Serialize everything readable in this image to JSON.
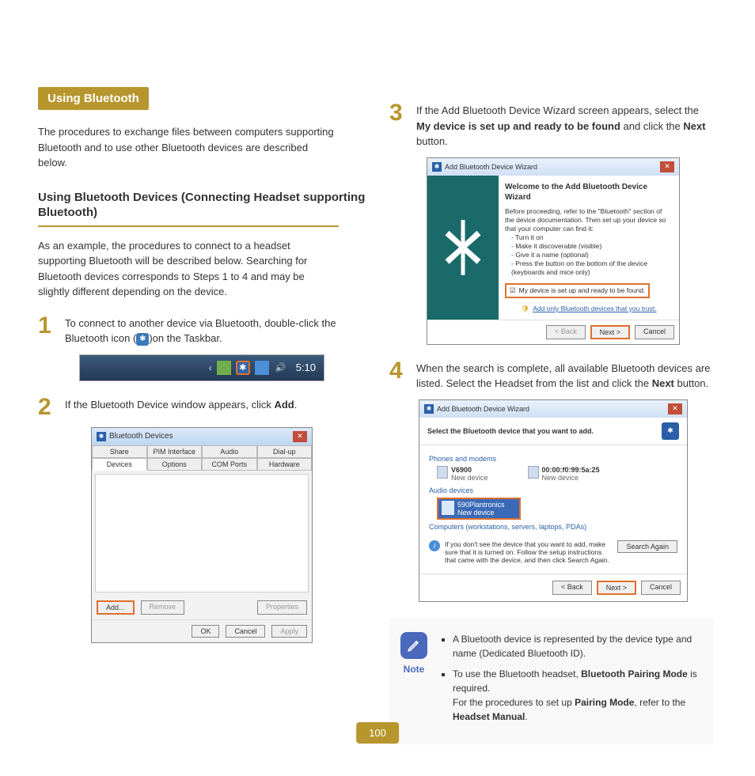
{
  "heading": "Using Bluetooth",
  "intro": "The procedures to exchange files between computers supporting Bluetooth and to use other Bluetooth devices are described below.",
  "sub_heading": "Using Bluetooth Devices (Connecting Headset supporting Bluetooth)",
  "sub_intro": "As an example, the procedures to connect to a headset supporting Bluetooth will be described below. Searching for Bluetooth devices corresponds to Steps 1 to 4 and may be slightly different depending on the device.",
  "step1": {
    "num": "1",
    "pre": "To connect to another device via Bluetooth, double-click the Bluetooth icon (",
    "post": ")on the Taskbar."
  },
  "taskbar": {
    "time": "5:10"
  },
  "step2": {
    "num": "2",
    "pre": "If the Bluetooth Device window appears, click ",
    "bold": "Add",
    "post": "."
  },
  "bt_devices_window": {
    "title": "Bluetooth Devices",
    "tabs_top": [
      "Share",
      "PIM Interface",
      "Audio",
      "Dial-up"
    ],
    "tabs_bottom": [
      "Devices",
      "Options",
      "COM Ports",
      "Hardware"
    ],
    "active_tab": "Devices",
    "buttons_row": {
      "add": "Add...",
      "remove": "Remove",
      "properties": "Properties"
    },
    "footer": {
      "ok": "OK",
      "cancel": "Cancel",
      "apply": "Apply"
    }
  },
  "step3": {
    "num": "3",
    "pre": "If the Add Bluetooth Device Wizard screen appears, select the ",
    "bold": "My device is set up and ready to be found",
    "mid": " and click the ",
    "bold2": "Next",
    "post": " button."
  },
  "wizard1": {
    "title": "Add Bluetooth Device Wizard",
    "welcome": "Welcome to the Add Bluetooth Device Wizard",
    "desc": "Before proceeding, refer to the \"Bluetooth\" section of the device documentation. Then set up your device so that your computer can find it:",
    "bullets": [
      "Turn it on",
      "Make it discoverable (visible)",
      "Give it a name (optional)",
      "Press the button on the bottom of the device (keyboards and mice only)"
    ],
    "checkbox": "My device is set up and ready to be found.",
    "link": "Add only Bluetooth devices that you trust.",
    "footer": {
      "back": "< Back",
      "next": "Next >",
      "cancel": "Cancel"
    }
  },
  "step4": {
    "num": "4",
    "pre": "When the search is complete, all available Bluetooth devices are listed. Select the Headset from the list and click the ",
    "bold": "Next",
    "post": " button."
  },
  "wizard2": {
    "title": "Add Bluetooth Device Wizard",
    "prompt": "Select the Bluetooth device that you want to add.",
    "cat1": "Phones and modems",
    "dev1": {
      "name": "V6900",
      "sub": "New device"
    },
    "dev2": {
      "name": "00:00:f0:99:5a:25",
      "sub": "New device"
    },
    "cat2": "Audio devices",
    "sel": {
      "name": "590Plantronics",
      "sub": "New device"
    },
    "cat3": "Computers (workstations, servers, laptops, PDAs)",
    "info": "If you don't see the device that you want to add, make sure that it is turned on. Follow the setup instructions that came with the device, and then click Search Again.",
    "search_again": "Search Again",
    "footer": {
      "back": "< Back",
      "next": "Next >",
      "cancel": "Cancel"
    }
  },
  "note": {
    "label": "Note",
    "b1": "A Bluetooth device is represented by the device type and name (Dedicated Bluetooth ID).",
    "b2_pre": "To use the Bluetooth headset, ",
    "b2_bold": "Bluetooth Pairing Mode",
    "b2_post": " is required.",
    "b2_line2_pre": "For the procedures to set up ",
    "b2_line2_bold": "Pairing Mode",
    "b2_line2_mid": ", refer to the ",
    "b2_line2_bold2": "Headset Manual",
    "b2_line2_post": "."
  },
  "page_number": "100"
}
